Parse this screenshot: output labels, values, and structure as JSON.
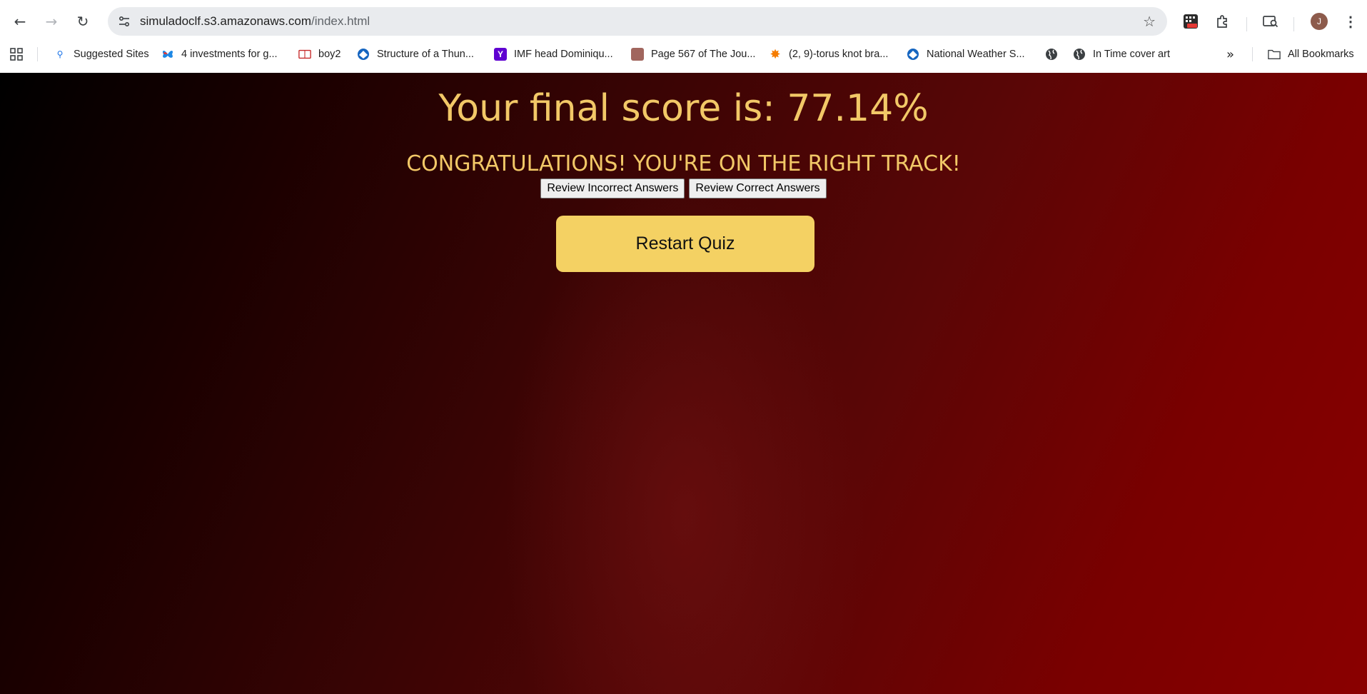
{
  "browser": {
    "url_host": "simuladoclf.s3.amazonaws.com",
    "url_path": "/index.html",
    "avatar_initial": "J",
    "bookmarks": [
      {
        "label": "Suggested Sites",
        "icon": "search-icon"
      },
      {
        "label": "4 investments for g...",
        "icon": "butterfly-icon"
      },
      {
        "label": "boy2",
        "icon": "book-icon"
      },
      {
        "label": "Structure of a Thun...",
        "icon": "noaa-icon"
      },
      {
        "label": "IMF head Dominiqu...",
        "icon": "yahoo-icon"
      },
      {
        "label": "Page 567 of The Jou...",
        "icon": "page-icon"
      },
      {
        "label": "(2, 9)-torus knot bra...",
        "icon": "gear-orange-icon"
      },
      {
        "label": "National Weather S...",
        "icon": "noaa-icon"
      },
      {
        "label": "",
        "icon": "globe-icon"
      },
      {
        "label": "In Time cover art",
        "icon": "globe-icon"
      }
    ],
    "all_bookmarks": "All Bookmarks"
  },
  "quiz": {
    "score_text": "Your final score is: 77.14%",
    "message": "CONGRATULATIONS! YOU'RE ON THE RIGHT TRACK!",
    "review_incorrect": "Review Incorrect Answers",
    "review_correct": "Review Correct Answers",
    "restart": "Restart Quiz"
  }
}
